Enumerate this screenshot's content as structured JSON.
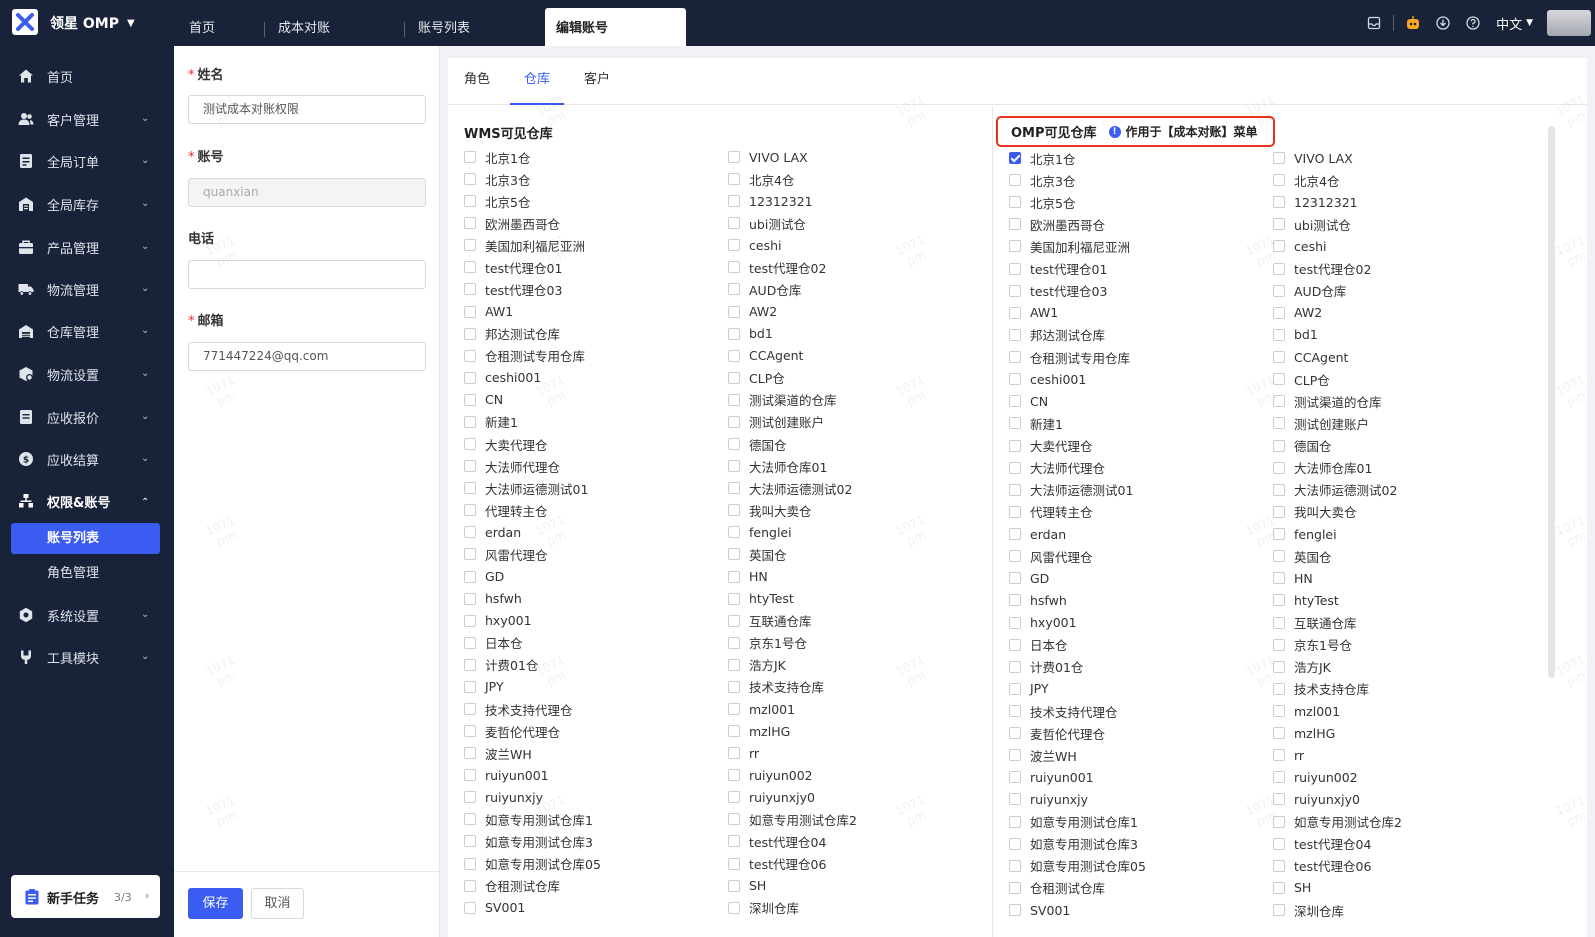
{
  "app": {
    "brand": "领星 OMP"
  },
  "topbar": {
    "tabs": [
      "首页",
      "成本对账",
      "账号列表",
      "编辑账号"
    ],
    "language": "中文"
  },
  "sidebar": {
    "items": [
      {
        "label": "首页",
        "icon": "home-icon"
      },
      {
        "label": "客户管理",
        "icon": "users-icon"
      },
      {
        "label": "全局订单",
        "icon": "orders-icon"
      },
      {
        "label": "全局库存",
        "icon": "inventory-icon"
      },
      {
        "label": "产品管理",
        "icon": "product-icon"
      },
      {
        "label": "物流管理",
        "icon": "truck-icon"
      },
      {
        "label": "仓库管理",
        "icon": "warehouse-icon"
      },
      {
        "label": "物流设置",
        "icon": "logistics-settings-icon"
      },
      {
        "label": "应收报价",
        "icon": "quote-icon"
      },
      {
        "label": "应收结算",
        "icon": "settlement-icon"
      },
      {
        "label": "权限&账号",
        "icon": "permission-icon"
      },
      {
        "label": "系统设置",
        "icon": "settings-icon"
      },
      {
        "label": "工具模块",
        "icon": "tools-icon"
      }
    ],
    "subitems": [
      "账号列表",
      "角色管理"
    ],
    "task": {
      "label": "新手任务",
      "count": "3/3"
    }
  },
  "form": {
    "name_label": "姓名",
    "name_value": "测试成本对账权限",
    "account_label": "账号",
    "account_value": "quanxian",
    "phone_label": "电话",
    "phone_value": "",
    "email_label": "邮箱",
    "email_value": "771447224@qq.com",
    "save_label": "保存",
    "cancel_label": "取消"
  },
  "panel": {
    "tabs": [
      "角色",
      "仓库",
      "客户"
    ],
    "active_tab": "仓库",
    "wms_title": "WMS可见仓库",
    "omp_title": "OMP可见仓库",
    "omp_note": "作用于【成本对账】菜单",
    "watermark": [
      "1071",
      "pm"
    ]
  },
  "warehouses": [
    "北京1仓",
    "VIVO LAX",
    "北京3仓",
    "北京4仓",
    "北京5仓",
    "12312321",
    "欧洲墨西哥仓",
    "ubi测试仓",
    "美国加利福尼亚洲",
    "ceshi",
    "test代理仓01",
    "test代理仓02",
    "test代理仓03",
    "AUD仓库",
    "AW1",
    "AW2",
    "邦达测试仓库",
    "bd1",
    "仓租测试专用仓库",
    "CCAgent",
    "ceshi001",
    "CLP仓",
    "CN",
    "测试渠道的仓库",
    "新建1",
    "测试创建账户",
    "大卖代理仓",
    "德国仓",
    "大法师代理仓",
    "大法师仓库01",
    "大法师运德测试01",
    "大法师运德测试02",
    "代理转主仓",
    "我叫大卖仓",
    "erdan",
    "fenglei",
    "风雷代理仓",
    "英国仓",
    "GD",
    "HN",
    "hsfwh",
    "htyTest",
    "hxy001",
    "互联通仓库",
    "日本仓",
    "京东1号仓",
    "计费01仓",
    "浩方JK",
    "JPY",
    "技术支持仓库",
    "技术支持代理仓",
    "mzl001",
    "麦哲伦代理仓",
    "mzlHG",
    "波兰WH",
    "rr",
    "ruiyun001",
    "ruiyun002",
    "ruiyunxjy",
    "ruiyunxjy0",
    "如意专用测试仓库1",
    "如意专用测试仓库2",
    "如意专用测试仓库3",
    "test代理仓04",
    "如意专用测试仓库05",
    "test代理仓06",
    "仓租测试仓库",
    "SH",
    "SV001",
    "深圳仓库"
  ],
  "omp_checked": [
    "北京1仓"
  ],
  "colors": {
    "accent": "#3a5cf0",
    "sidebar_bg": "#18233a",
    "highlight_border": "#e8321f"
  }
}
